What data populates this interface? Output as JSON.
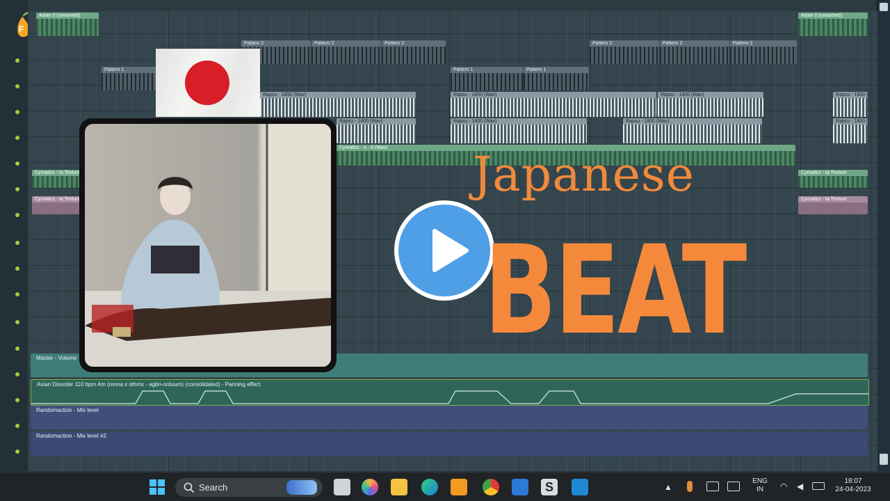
{
  "playlist": {
    "top_audio_label": "Asian 0 (unnamed)",
    "pattern_label": "Pattern 1",
    "pattern2_label": "Pattern 2",
    "audio_label": "Rapsu - 1800 (Wav)",
    "cymatics_label": "Cymatics - o - 8 (Wav)",
    "cymatics_texture_label": "Cymatics - ta Texture",
    "master_label": "Master - Volume",
    "main_track_label": "Asian Disorder 110 bpm Am (omna x othmx - agbn-ontuum) (consolidated) - Panning effect",
    "random1_label": "Randomaction - Mix level",
    "random2_label": "Randomaction - Mix level #2"
  },
  "thumbnail": {
    "title_line1": "Japanese",
    "title_line2": "BEAT",
    "title_color": "#f5893b",
    "flag_sun_color": "#d81e26",
    "play_button_color": "#4f9fe6",
    "play_icon": "play-triangle-icon"
  },
  "taskbar": {
    "search_placeholder": "Search",
    "language": "ENG",
    "region": "IN",
    "time": "18:07",
    "date": "24-04-2023",
    "icons": [
      "windows-start-icon",
      "search-icon",
      "task-view-icon",
      "copilot-icon",
      "file-explorer-icon",
      "edge-browser-icon",
      "fl-studio-icon",
      "chrome-icon",
      "photos-icon",
      "s-app-icon",
      "vscode-icon"
    ]
  }
}
